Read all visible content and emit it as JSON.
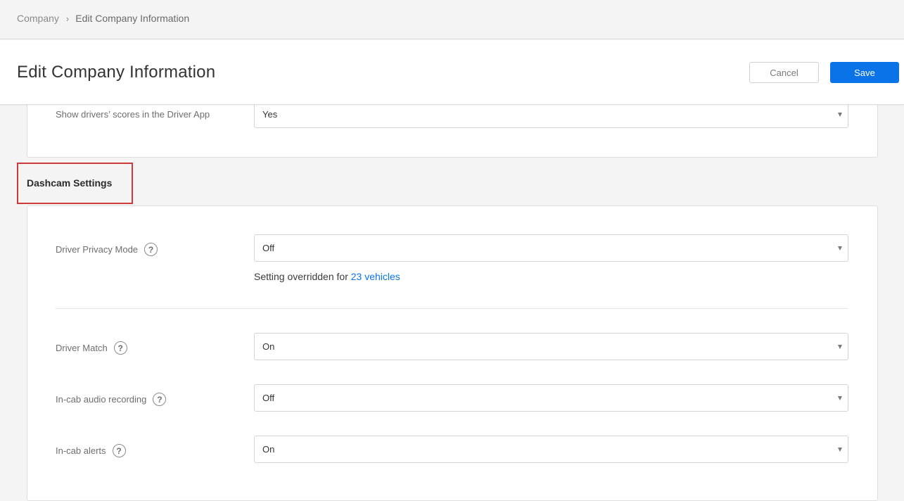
{
  "breadcrumb": {
    "parent": "Company",
    "separator": "›",
    "current": "Edit Company Information"
  },
  "header": {
    "title": "Edit Company Information",
    "cancel_label": "Cancel",
    "save_label": "Save"
  },
  "colors": {
    "accent": "#0a73e8",
    "highlight": "#d0393a"
  },
  "top_section": {
    "fields": [
      {
        "label": "Show drivers’ scores in the Driver App",
        "value": "Yes"
      }
    ]
  },
  "dashcam": {
    "title": "Dashcam Settings",
    "privacy": {
      "label": "Driver Privacy Mode",
      "help_icon": "question-circle-icon",
      "value": "Off",
      "override_prefix": "Setting overridden for ",
      "override_link": "23 vehicles"
    },
    "driver_match": {
      "label": "Driver Match",
      "help_icon": "question-circle-icon",
      "value": "On"
    },
    "audio": {
      "label": "In-cab audio recording",
      "help_icon": "question-circle-icon",
      "value": "Off"
    },
    "alerts": {
      "label": "In-cab alerts",
      "help_icon": "question-circle-icon",
      "value": "On"
    }
  }
}
